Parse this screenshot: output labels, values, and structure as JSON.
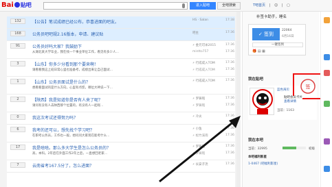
{
  "header": {
    "logo_text": "Bai",
    "logo_suffix": "贴吧",
    "search_value": "",
    "enter_button": "进入贴吧",
    "search_all_button": "全吧搜索",
    "topright": [
      "T吧首页",
      "|",
      "☺",
      "|",
      "▢"
    ]
  },
  "threads": [
    {
      "reply": "132",
      "title": "【公告】笔试成绩已经公布，恭喜进面的吧友。",
      "tag": "",
      "author": "HS · Salan",
      "lastr": "",
      "time": "17:38",
      "time2": "",
      "highlight": true
    },
    {
      "reply": "168",
      "title": "公务员吧吧规2.16版本，申请、建议贴",
      "tag": "",
      "author": "吧主",
      "lastr": "",
      "time": "17:36",
      "time2": "",
      "highlight": true
    },
    {
      "reply": "91",
      "title": "公务员好吗大家？我鼓励下",
      "tag": "",
      "excerpt": "从湖北某大学毕业，我在找一个事业单位工作，看见有多少人…",
      "author": "⚡ 金元可米2015",
      "lastr": "mintto757",
      "time": "17:36",
      "time2": "17:36",
      "highlight": false
    },
    {
      "reply": "3",
      "title": "【山东】你多少分看到那个要来啊！",
      "tag": "",
      "excerpt": "请看看我这上班日常心里也准备考，成绩出来让自己面试…",
      "author": "⚡ 行成成入TOM",
      "lastr": "⚡ 行成成入TOM",
      "time": "17:36",
      "time2": "17:36",
      "highlight": false
    },
    {
      "reply": "1",
      "title": "【山东】公务员面试是什么的？",
      "tag": "",
      "excerpt": "想看看面试的是什么方向，心里有点慌，哪位大神说一下…",
      "author": "⚡ 行成成入TOM",
      "lastr": "",
      "time": "17:36",
      "time2": "",
      "highlight": false
    },
    {
      "reply": "2",
      "title": "【陕西】我是知道你是否有人来了呢？",
      "tag": "",
      "excerpt": "请问有没有人去陕西那个位置的，有没有人一起呢…",
      "author": "⚡ 罗铸铭",
      "lastr": "⚡ 罗铸铭",
      "time": "17:36",
      "time2": "17:36",
      "highlight": false
    },
    {
      "reply": "0",
      "title": "我这次考试还得努力吗？",
      "tag": "",
      "excerpt": "",
      "author": "⚡ 冷炎",
      "lastr": "",
      "time": "17:36",
      "time2": "",
      "highlight": false
    },
    {
      "reply": "6",
      "title": "我考的还可以，想先找个学习吧？",
      "tag": "",
      "excerpt": "在职考公务员，工作也一般，想问问大家现在能考什么…",
      "author": "⚡ 小鱼",
      "lastr": "⚡ 松竹溪雨",
      "time": "17:36",
      "time2": "17:36",
      "highlight": false
    },
    {
      "reply": "17",
      "title": "我是啥啥。那么多大学生是怎么公务员的？",
      "tag": "",
      "excerpt": "高，本科。2年后在外面工作2年之后，一直想回老家…",
      "author": "⚡ 罗铸铭",
      "lastr": "⚡ 罗铸铭",
      "time": "17:36",
      "time2": "17:36",
      "highlight": false
    },
    {
      "reply": "7",
      "title": "云南省考167.5分了，怎么进面？",
      "tag": "",
      "excerpt": "",
      "author": "⚡ 长安子尧",
      "lastr": "",
      "time": "17:36",
      "time2": "",
      "highlight": false
    }
  ],
  "sidebar": {
    "title": "补签卡助手，睡名",
    "sign_button": "✓ 签到",
    "sign_count": "22064",
    "sign_date": "6月16日",
    "one_click": "一键签到",
    "member_section": "我在贴吧",
    "member_name": "蓝色海贝",
    "member_rank": "当前：1163",
    "red_label_1": "贴吧会员卡片",
    "red_label_2": "查看详情",
    "my_section": "我在本吧",
    "stats_label": "当前：32995",
    "stats_rank": "初级",
    "progress": 0.6,
    "stats_bottom": "本吧福利影星",
    "stats_link": "1-0467 (吧福利影星)"
  }
}
